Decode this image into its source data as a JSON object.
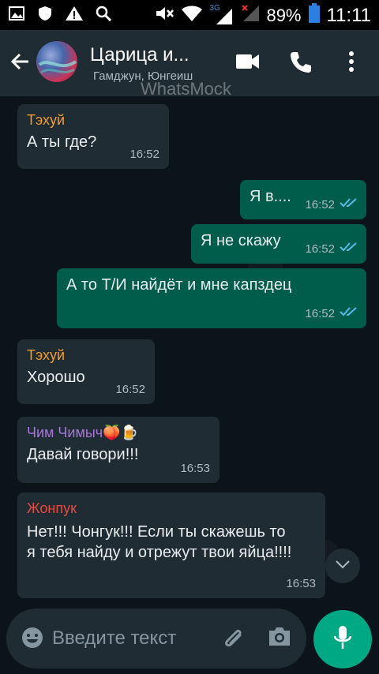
{
  "statusbar": {
    "network": "3G",
    "battery_pct": "89%",
    "time": "11:11"
  },
  "header": {
    "title": "Царица и...",
    "subtitle": "Гамджун, Юнгеиш",
    "watermark": "WhatsMock"
  },
  "messages": [
    {
      "type": "in",
      "sender": "Тэхуй",
      "sender_color": "#f39c2c",
      "text": "А ты где?",
      "time": "16:52"
    },
    {
      "type": "out",
      "text": "Я в....",
      "time": "16:52"
    },
    {
      "type": "out",
      "text": "Я не скажу",
      "time": "16:52"
    },
    {
      "type": "out",
      "text": "А то Т/И найдёт и мне капздец",
      "time": "16:52"
    },
    {
      "type": "in",
      "sender": "Тэхуй",
      "sender_color": "#f39c2c",
      "text": "Хорошо",
      "time": "16:52"
    },
    {
      "type": "in",
      "sender": "Чим Чимыч🍑🍺",
      "sender_color": "#a776d8",
      "text": "Давай говори!!!",
      "time": "16:53"
    },
    {
      "type": "in",
      "sender": "Жонпук",
      "sender_color": "#e84a3f",
      "text": "Нет!!! Чонгук!!! Если ты скажешь то я тебя найду и отрежут твои яйца!!!!",
      "time": "16:53"
    }
  ],
  "composer": {
    "placeholder": "Введите текст"
  },
  "colors": {
    "header_bg": "#1f2c34",
    "incoming_bubble": "#1f2c34",
    "outgoing_bubble": "#005c4b",
    "accent": "#00a884",
    "tick_blue": "#53bdeb"
  }
}
